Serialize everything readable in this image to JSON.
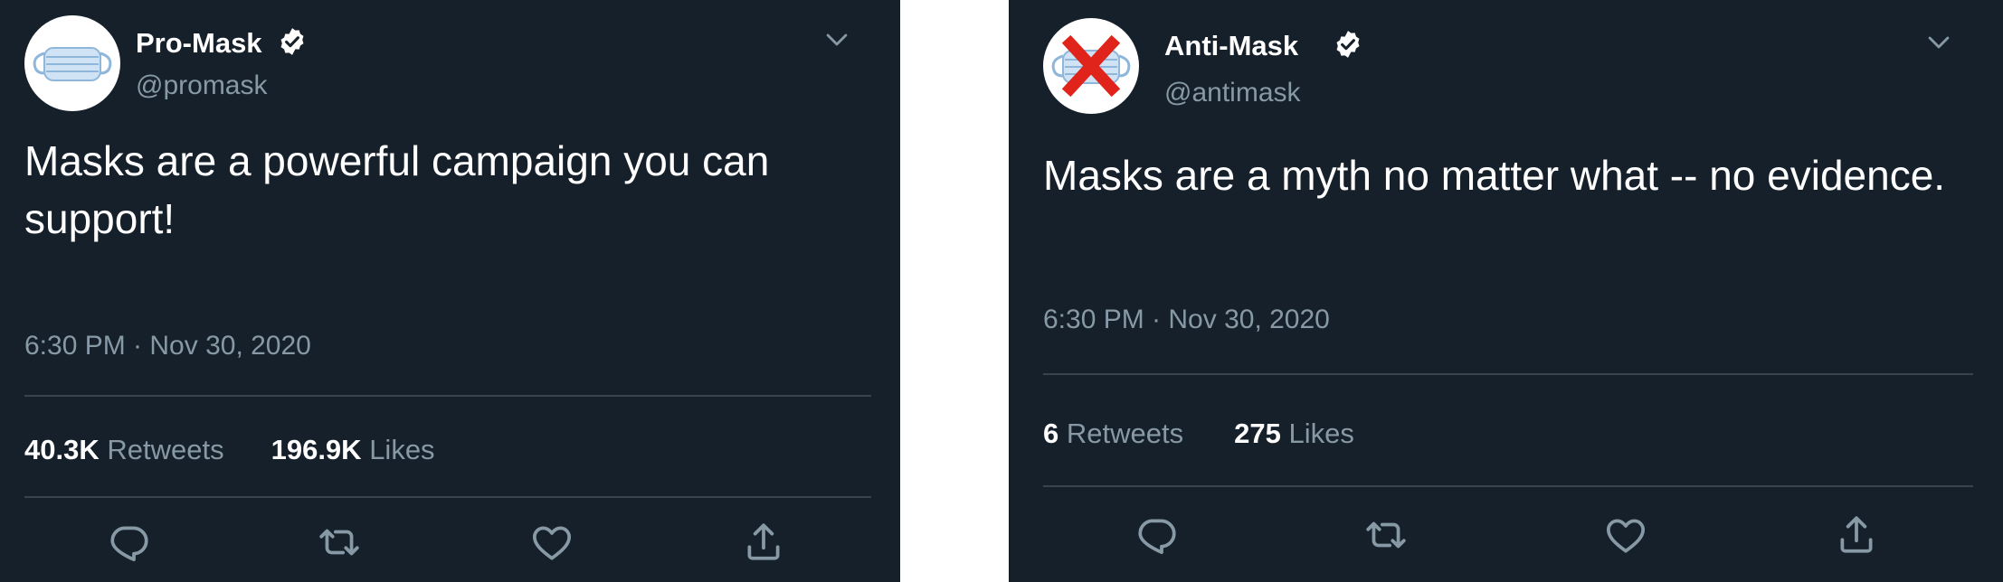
{
  "tweets": [
    {
      "display_name": "Pro-Mask",
      "handle": "@promask",
      "avatar_icon": "surgical-mask-icon",
      "verified_icon": "verified-badge-icon",
      "text": "Masks are a powerful campaign you can support!",
      "timestamp": "6:30 PM · Nov 30, 2020",
      "retweets_count": "40.3K",
      "retweets_label": "Retweets",
      "likes_count": "196.9K",
      "likes_label": "Likes"
    },
    {
      "display_name": "Anti-Mask",
      "handle": "@antimask",
      "avatar_icon": "crossed-out-mask-icon",
      "verified_icon": "verified-badge-icon",
      "text": "Masks are a myth no matter what -- no evidence.",
      "timestamp": "6:30 PM · Nov 30, 2020",
      "retweets_count": "6",
      "retweets_label": "Retweets",
      "likes_count": "275",
      "likes_label": "Likes"
    }
  ],
  "actions": [
    "reply-icon",
    "retweet-icon",
    "like-icon",
    "share-icon"
  ],
  "colors": {
    "background": "#15202b",
    "text": "#ffffff",
    "secondary_text": "#8899a6",
    "divider": "#38444d",
    "cross": "#e0241b"
  }
}
